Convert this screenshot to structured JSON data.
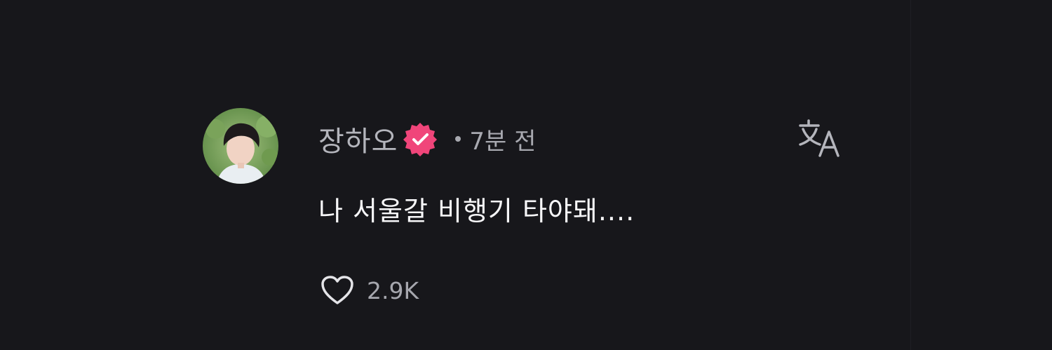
{
  "comment": {
    "author": "장하오",
    "verified": true,
    "time_ago": "7분 전",
    "text": "나 서울갈 비행기 타야돼....",
    "likes": "2.9K"
  },
  "icons": {
    "verified": "verified-badge-icon",
    "translate": "translate-icon",
    "like": "heart-icon"
  },
  "colors": {
    "background": "#17171b",
    "verified_badge": "#f0457a",
    "secondary_text": "#a8a9b0",
    "primary_text": "#f7f7f9"
  }
}
